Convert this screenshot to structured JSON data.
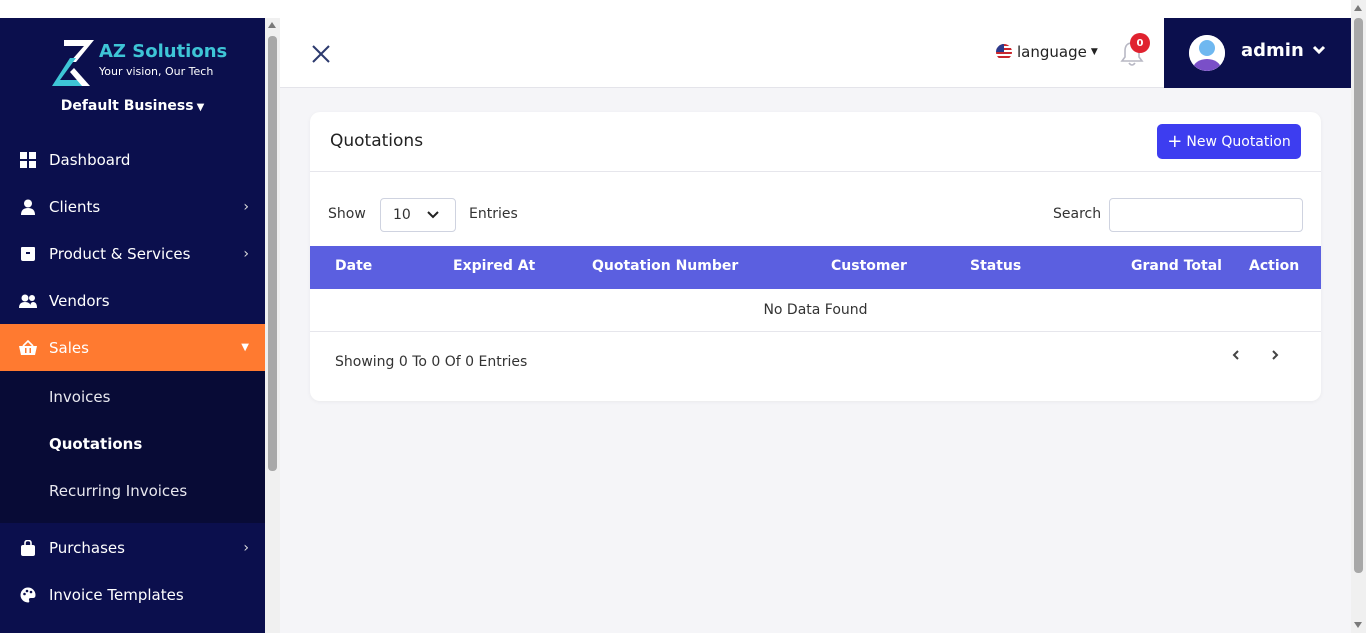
{
  "brand": {
    "name": "AZ Solutions",
    "tagline": "Your vision, Our Tech",
    "colors": {
      "sidebar": "#0b0f4d",
      "accent": "#ff7a30",
      "primary": "#3d3df0",
      "table_header": "#5b5fe0"
    }
  },
  "business": {
    "label": "Default Business"
  },
  "sidebar": {
    "items": [
      {
        "label": "Dashboard",
        "icon": "dashboard-icon"
      },
      {
        "label": "Clients",
        "icon": "user-icon"
      },
      {
        "label": "Product & Services",
        "icon": "box-icon"
      },
      {
        "label": "Vendors",
        "icon": "users-icon"
      },
      {
        "label": "Sales",
        "icon": "basket-icon"
      },
      {
        "label": "Purchases",
        "icon": "bag-icon"
      },
      {
        "label": "Invoice Templates",
        "icon": "palette-icon"
      }
    ],
    "sales_sub": [
      {
        "label": "Invoices"
      },
      {
        "label": "Quotations"
      },
      {
        "label": "Recurring Invoices"
      }
    ]
  },
  "header": {
    "language_label": "language",
    "notifications_count": "0",
    "user_name": "admin"
  },
  "page": {
    "title": "Quotations",
    "new_button_label": "New Quotation",
    "show_label": "Show",
    "entries_value": "10",
    "entries_label": "Entries",
    "search_label": "Search",
    "search_value": "",
    "columns": [
      "Date",
      "Expired At",
      "Quotation Number",
      "Customer",
      "Status",
      "Grand Total",
      "Action"
    ],
    "empty_message": "No Data Found",
    "footer_text": "Showing 0 To 0 Of 0 Entries"
  }
}
